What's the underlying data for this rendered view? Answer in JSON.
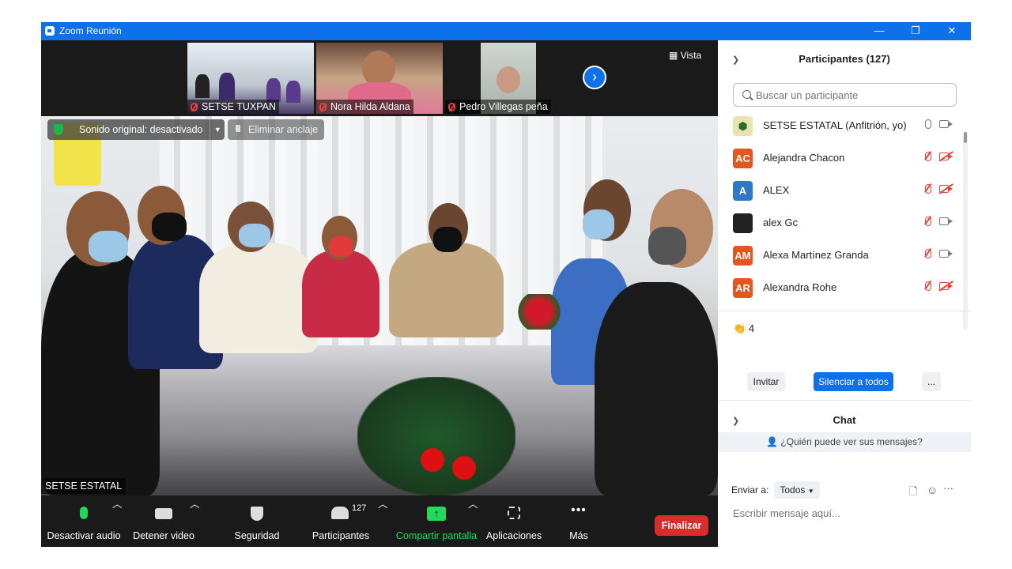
{
  "window": {
    "title": "Zoom Reunión",
    "minimize": "—",
    "restore": "❐",
    "close": "✕"
  },
  "thumbnails": [
    {
      "name": "SETSE TUXPAN"
    },
    {
      "name": "Nora Hilda Aldana"
    },
    {
      "name": "Pedro Villegas peña"
    }
  ],
  "view_button": "Vista",
  "badges": {
    "original_sound": "Sonido original: desactivado",
    "unpin": "Eliminar anclaje"
  },
  "main_speaker_label": "SETSE ESTATAL",
  "toolbar": {
    "mute": "Desactivar audio",
    "stop_video": "Detener video",
    "security": "Seguridad",
    "participants": "Participantes",
    "participants_count": "127",
    "share_screen": "Compartir pantalla",
    "apps": "Aplicaciones",
    "more": "Más",
    "end": "Finalizar"
  },
  "participants_panel": {
    "title": "Participantes (127)",
    "search_placeholder": "Buscar un participante",
    "list": [
      {
        "initials": "",
        "name": "SETSE ESTATAL (Anfitrión, yo)",
        "color": "#e9e3b0",
        "mic_muted": false,
        "cam_off": false
      },
      {
        "initials": "AC",
        "name": "Alejandra Chacon",
        "color": "#e2571f",
        "mic_muted": true,
        "cam_off": true
      },
      {
        "initials": "A",
        "name": "ALEX",
        "color": "#2e78c7",
        "mic_muted": true,
        "cam_off": true
      },
      {
        "initials": "",
        "name": "alex Gc",
        "color": "#222222",
        "mic_muted": true,
        "cam_off": false
      },
      {
        "initials": "AM",
        "name": "Alexa Martínez Granda",
        "color": "#e2571f",
        "mic_muted": true,
        "cam_off": false
      },
      {
        "initials": "AR",
        "name": "Alexandra Rohe",
        "color": "#e2571f",
        "mic_muted": true,
        "cam_off": true
      }
    ],
    "reactions": {
      "emoji": "👏",
      "count": "4"
    },
    "invite": "Invitar",
    "mute_all": "Silenciar a todos",
    "more": "..."
  },
  "chat": {
    "title": "Chat",
    "who_can_see": "¿Quién puede ver sus mensajes?",
    "send_to_label": "Enviar a:",
    "send_to_value": "Todos",
    "placeholder": "Escribir mensaje aquí..."
  },
  "colors": {
    "zoom_blue": "#0e71eb",
    "end_red": "#d92d2d",
    "share_green": "#23d959"
  }
}
